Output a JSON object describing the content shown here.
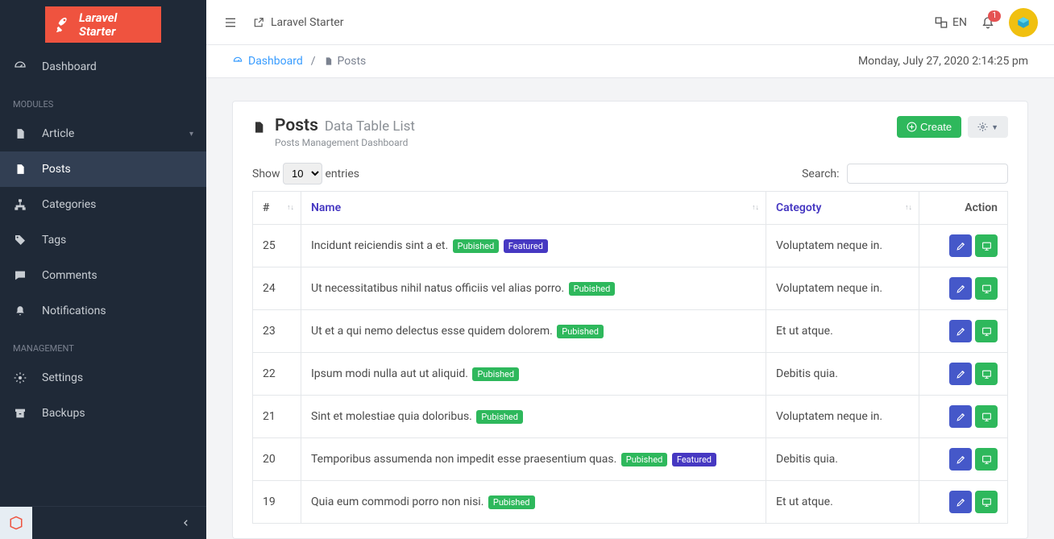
{
  "brand": {
    "name": "Laravel Starter"
  },
  "sidebar": {
    "dashboard": "Dashboard",
    "modules_header": "MODULES",
    "management_header": "MANAGEMENT",
    "article": "Article",
    "posts": "Posts",
    "categories": "Categories",
    "tags": "Tags",
    "comments": "Comments",
    "notifications": "Notifications",
    "settings": "Settings",
    "backups": "Backups"
  },
  "topbar": {
    "app_link_label": "Laravel Starter",
    "lang": "EN",
    "notification_count": "1"
  },
  "breadcrumb": {
    "root": "Dashboard",
    "sep": "/",
    "current": "Posts",
    "timestamp": "Monday, July 27, 2020 2:14:25 pm"
  },
  "card": {
    "title": "Posts",
    "subtitle": "Data Table List",
    "description": "Posts Management Dashboard",
    "create_label": "Create"
  },
  "dt": {
    "show_label_pre": "Show",
    "show_label_post": "entries",
    "show_value": "10",
    "search_label": "Search:",
    "search_value": "",
    "columns": {
      "id": "#",
      "name": "Name",
      "category": "Categoty",
      "action": "Action"
    },
    "badge_published": "Pubished",
    "badge_featured": "Featured",
    "rows": [
      {
        "id": "25",
        "name": "Incidunt reiciendis sint a et.",
        "published": true,
        "featured": true,
        "category": "Voluptatem neque in."
      },
      {
        "id": "24",
        "name": "Ut necessitatibus nihil natus officiis vel alias porro.",
        "published": true,
        "featured": false,
        "category": "Voluptatem neque in."
      },
      {
        "id": "23",
        "name": "Ut et a qui nemo delectus esse quidem dolorem.",
        "published": true,
        "featured": false,
        "category": "Et ut atque."
      },
      {
        "id": "22",
        "name": "Ipsum modi nulla aut ut aliquid.",
        "published": true,
        "featured": false,
        "category": "Debitis quia."
      },
      {
        "id": "21",
        "name": "Sint et molestiae quia doloribus.",
        "published": true,
        "featured": false,
        "category": "Voluptatem neque in."
      },
      {
        "id": "20",
        "name": "Temporibus assumenda non impedit esse praesentium quas.",
        "published": true,
        "featured": true,
        "category": "Debitis quia."
      },
      {
        "id": "19",
        "name": "Quia eum commodi porro non nisi.",
        "published": true,
        "featured": false,
        "category": "Et ut atque."
      }
    ]
  },
  "icons": {
    "dashboard": "speedometer",
    "article": "file",
    "posts": "file",
    "categories": "sitemap",
    "tags": "tags",
    "comments": "comment",
    "notifications": "bell",
    "settings": "gears",
    "backups": "archive"
  },
  "colors": {
    "accent": "#2eb85c",
    "primary": "#4638c2",
    "brand": "#ef533f"
  }
}
